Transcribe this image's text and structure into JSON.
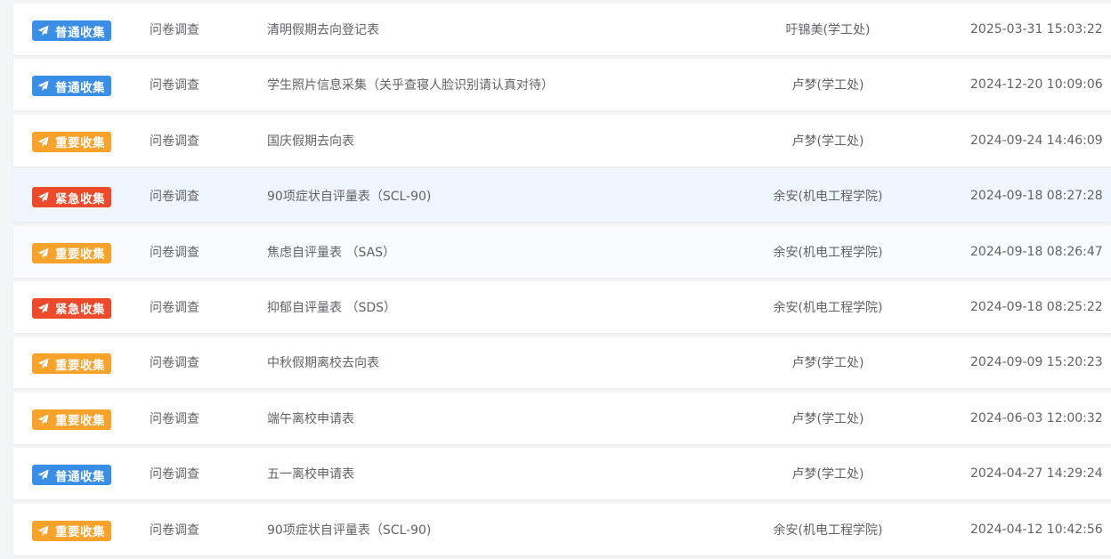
{
  "colors": {
    "normal": "#3a8ee6",
    "important": "#f7a22b",
    "urgent": "#ec4a2a"
  },
  "icon": "send-icon",
  "rows": [
    {
      "badge": "普通收集",
      "level": "normal",
      "type": "问卷调查",
      "title": "清明假期去向登记表",
      "author": "吁锦美(学工处)",
      "time": "2025-03-31 15:03:22"
    },
    {
      "badge": "普通收集",
      "level": "normal",
      "type": "问卷调查",
      "title": "学生照片信息采集（关乎查寝人脸识别请认真对待）",
      "author": "卢梦(学工处)",
      "time": "2024-12-20 10:09:06"
    },
    {
      "badge": "重要收集",
      "level": "important",
      "type": "问卷调查",
      "title": "国庆假期去向表",
      "author": "卢梦(学工处)",
      "time": "2024-09-24 14:46:09"
    },
    {
      "badge": "紧急收集",
      "level": "urgent",
      "type": "问卷调查",
      "title": "90项症状自评量表（SCL-90)",
      "author": "余安(机电工程学院)",
      "time": "2024-09-18 08:27:28"
    },
    {
      "badge": "重要收集",
      "level": "important",
      "type": "问卷调查",
      "title": "焦虑自评量表 （SAS）",
      "author": "余安(机电工程学院)",
      "time": "2024-09-18 08:26:47"
    },
    {
      "badge": "紧急收集",
      "level": "urgent",
      "type": "问卷调查",
      "title": "抑郁自评量表 （SDS）",
      "author": "余安(机电工程学院)",
      "time": "2024-09-18 08:25:22"
    },
    {
      "badge": "重要收集",
      "level": "important",
      "type": "问卷调查",
      "title": "中秋假期离校去向表",
      "author": "卢梦(学工处)",
      "time": "2024-09-09 15:20:23"
    },
    {
      "badge": "重要收集",
      "level": "important",
      "type": "问卷调查",
      "title": "端午离校申请表",
      "author": "卢梦(学工处)",
      "time": "2024-06-03 12:00:32"
    },
    {
      "badge": "普通收集",
      "level": "normal",
      "type": "问卷调查",
      "title": "五一离校申请表",
      "author": "卢梦(学工处)",
      "time": "2024-04-27 14:29:24"
    },
    {
      "badge": "重要收集",
      "level": "important",
      "type": "问卷调查",
      "title": "90项症状自评量表（SCL-90)",
      "author": "余安(机电工程学院)",
      "time": "2024-04-12 10:42:56"
    }
  ]
}
